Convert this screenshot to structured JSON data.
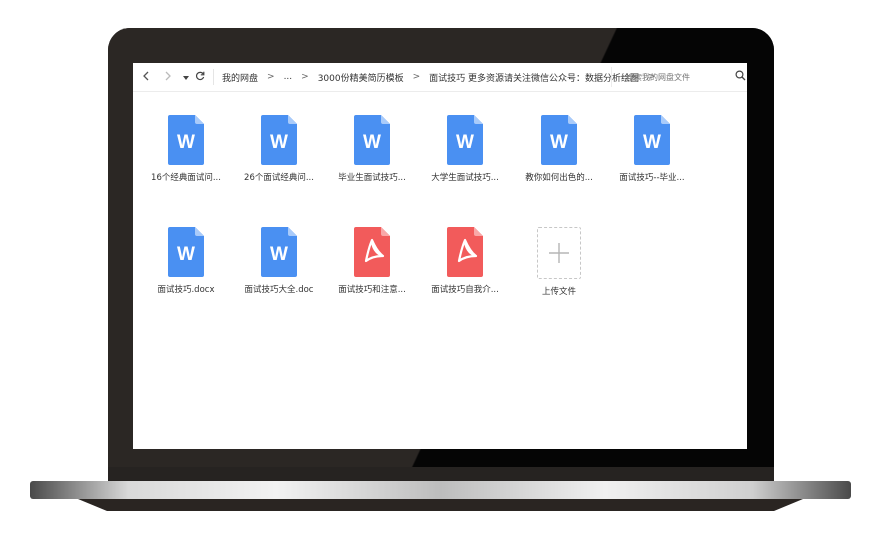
{
  "toolbar": {
    "back_icon": "chevron-left-icon",
    "forward_icon": "chevron-right-icon",
    "history_icon": "caret-down-icon",
    "refresh_icon": "refresh-icon",
    "breadcrumbs": [
      "我的网盘",
      "...",
      "3000份精美简历模板",
      "面试技巧 更多资源请关注微信公众号：数据分析绘图"
    ],
    "separator": ">",
    "search_placeholder": "搜索我的网盘文件"
  },
  "files": [
    {
      "name": "16个经典面试问...",
      "type": "word"
    },
    {
      "name": "26个面试经典问...",
      "type": "word"
    },
    {
      "name": "毕业生面试技巧...",
      "type": "word"
    },
    {
      "name": "大学生面试技巧...",
      "type": "word"
    },
    {
      "name": "教你如何出色的...",
      "type": "word"
    },
    {
      "name": "面试技巧--毕业...",
      "type": "word"
    },
    {
      "name": "面试技巧.docx",
      "type": "word"
    },
    {
      "name": "面试技巧大全.doc",
      "type": "word"
    },
    {
      "name": "面试技巧和注意...",
      "type": "pdf"
    },
    {
      "name": "面试技巧自我介...",
      "type": "pdf"
    }
  ],
  "upload": {
    "label": "上传文件"
  },
  "colors": {
    "word": "#4a90f2",
    "word_fold": "#a9cbfa",
    "pdf": "#f25b5b",
    "pdf_fold": "#f9a8a8"
  }
}
